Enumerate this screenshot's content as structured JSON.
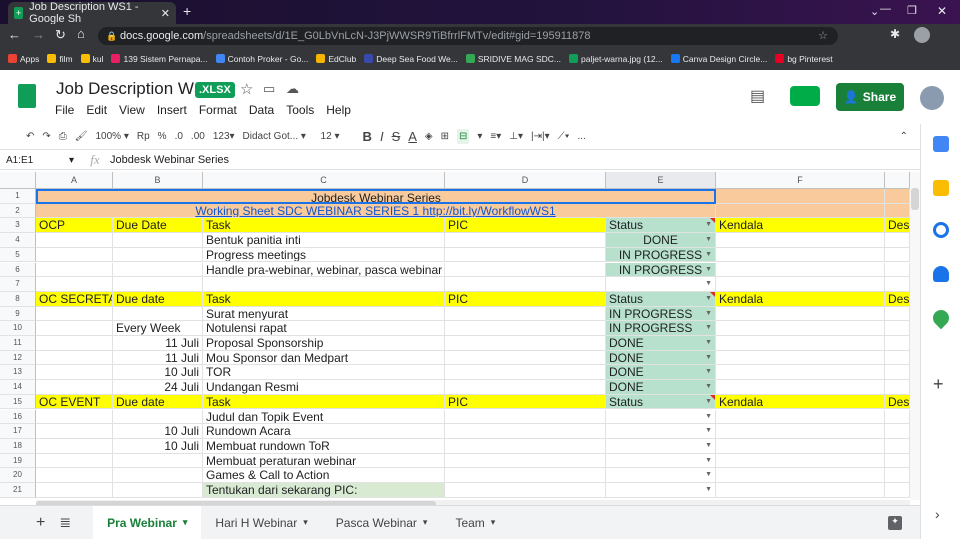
{
  "browser": {
    "tab_title": "Job Description WS1 - Google Sh",
    "url_domain": "docs.google.com",
    "url_path": "/spreadsheets/d/1E_G0LbVnLcN-J3PjWWSR9TiBfrrlFMTv/edit#gid=195911878",
    "bookmarks": [
      "Apps",
      "film",
      "kul",
      "139 Sistem Pernapa...",
      "Contoh Proker - Go...",
      "EdClub",
      "Deep Sea Food We...",
      "SRIDIVE MAG SDC...",
      "paljet-warna.jpg (12...",
      "Canva Design Circle...",
      "bg Pinterest"
    ]
  },
  "sheets": {
    "title": "Job Description WS1",
    "badge": ".XLSX",
    "menu": [
      "File",
      "Edit",
      "View",
      "Insert",
      "Format",
      "Data",
      "Tools",
      "Help"
    ],
    "share_label": "Share",
    "toolbar": {
      "zoom": "100%",
      "currency": "Rp",
      "percent": "%",
      "dec_less": ".0",
      "dec_more": ".00",
      "format": "123",
      "font": "Didact Got...",
      "size": "12",
      "bold": "B",
      "italic": "I",
      "strike": "S",
      "textcolor": "A",
      "more": "..."
    },
    "name_box": "A1:E1",
    "fx": "fx",
    "formula": "Jobdesk Webinar Series"
  },
  "columns": [
    "A",
    "B",
    "C",
    "D",
    "E",
    "F"
  ],
  "rows": [
    {
      "n": "1",
      "kind": "title",
      "merged": "Jobdesk Webinar Series"
    },
    {
      "n": "2",
      "kind": "link",
      "merged": "Working Sheet SDC WEBINAR SERIES 1 http://bit.ly/WorkflowWS1"
    },
    {
      "n": "3",
      "kind": "header",
      "cells": [
        "OCP",
        "Due Date",
        "Task",
        "PIC",
        "Status",
        "Kendala",
        "Des"
      ]
    },
    {
      "n": "4",
      "kind": "center",
      "cells": [
        "",
        "",
        "Bentuk panitia inti",
        "",
        "DONE",
        "",
        ""
      ]
    },
    {
      "n": "5",
      "kind": "center",
      "cells": [
        "",
        "",
        "Progress meetings",
        "",
        "IN PROGRESS",
        "",
        ""
      ]
    },
    {
      "n": "6",
      "kind": "center",
      "cells": [
        "",
        "",
        "Handle pra-webinar, webinar, pasca webinar",
        "",
        "IN PROGRESS",
        "",
        ""
      ]
    },
    {
      "n": "7",
      "kind": "empty",
      "cells": [
        "",
        "",
        "",
        "",
        "",
        "",
        ""
      ]
    },
    {
      "n": "8",
      "kind": "header",
      "cells": [
        "OC SECRETARY",
        "Due date",
        "Task",
        "PIC",
        "Status",
        "Kendala",
        "Des"
      ]
    },
    {
      "n": "9",
      "kind": "status",
      "cells": [
        "",
        "",
        "Surat menyurat",
        "",
        "IN PROGRESS",
        "",
        ""
      ]
    },
    {
      "n": "10",
      "kind": "status",
      "cells": [
        "",
        "Every Week",
        "Notulensi rapat",
        "",
        "IN PROGRESS",
        "",
        ""
      ]
    },
    {
      "n": "11",
      "kind": "status",
      "cells": [
        "",
        "11 Juli",
        "Proposal Sponsorship",
        "",
        "DONE",
        "",
        ""
      ]
    },
    {
      "n": "12",
      "kind": "status",
      "cells": [
        "",
        "11 Juli",
        "Mou Sponsor dan Medpart",
        "",
        "DONE",
        "",
        ""
      ]
    },
    {
      "n": "13",
      "kind": "status",
      "cells": [
        "",
        "10 Juli",
        "TOR",
        "",
        "DONE",
        "",
        ""
      ]
    },
    {
      "n": "14",
      "kind": "status",
      "cells": [
        "",
        "24 Juli",
        "Undangan Resmi",
        "",
        "DONE",
        "",
        ""
      ]
    },
    {
      "n": "15",
      "kind": "header",
      "cells": [
        "OC EVENT",
        "Due date",
        "Task",
        "PIC",
        "Status",
        "Kendala",
        "Des"
      ]
    },
    {
      "n": "16",
      "kind": "empty",
      "cells": [
        "",
        "",
        "Judul dan Topik Event",
        "",
        "",
        "",
        ""
      ]
    },
    {
      "n": "17",
      "kind": "empty",
      "cells": [
        "",
        "10 Juli",
        "Rundown Acara",
        "",
        "",
        "",
        ""
      ]
    },
    {
      "n": "18",
      "kind": "empty",
      "cells": [
        "",
        "10 Juli",
        "Membuat rundown ToR",
        "",
        "",
        "",
        ""
      ]
    },
    {
      "n": "19",
      "kind": "empty",
      "cells": [
        "",
        "",
        "Membuat peraturan webinar",
        "",
        "",
        "",
        ""
      ]
    },
    {
      "n": "20",
      "kind": "empty",
      "cells": [
        "",
        "",
        "Games & Call to Action",
        "",
        "",
        "",
        ""
      ]
    },
    {
      "n": "21",
      "kind": "pic",
      "cells": [
        "",
        "",
        "Tentukan dari sekarang PIC:",
        "",
        "",
        "",
        ""
      ]
    }
  ],
  "sheet_tabs": [
    "Pra Webinar",
    "Hari H Webinar",
    "Pasca Webinar",
    "Team"
  ],
  "colors": {
    "peach": "#f9cb9c",
    "yellow": "#ffff00",
    "green": "#b7e1cd",
    "lightgreen": "#d9ead3",
    "brand": "#188038"
  }
}
